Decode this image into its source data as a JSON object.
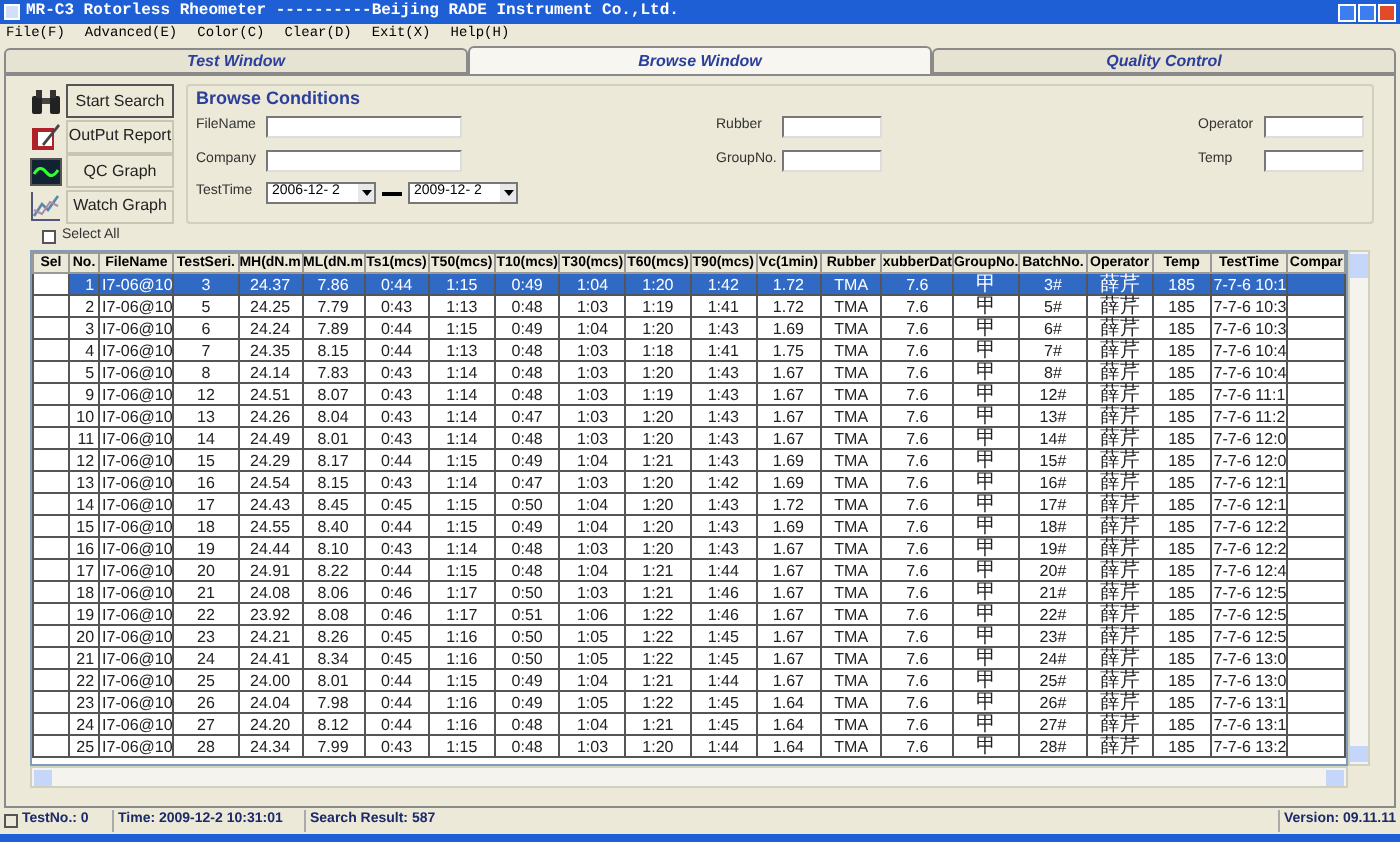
{
  "window": {
    "title": "MR-C3 Rotorless Rheometer ----------Beijing RADE Instrument Co.,Ltd."
  },
  "menu": [
    {
      "label": "File(F)"
    },
    {
      "label": "Advanced(E)"
    },
    {
      "label": "Color(C)"
    },
    {
      "label": "Clear(D)"
    },
    {
      "label": "Exit(X)"
    },
    {
      "label": "Help(H)"
    }
  ],
  "tabs": [
    {
      "label": "Test Window",
      "selected": false
    },
    {
      "label": "Browse Window",
      "selected": true
    },
    {
      "label": "Quality Control",
      "selected": false
    }
  ],
  "actions": [
    {
      "label": "Start Search"
    },
    {
      "label": "OutPut Report"
    },
    {
      "label": "QC Graph"
    },
    {
      "label": "Watch Graph"
    }
  ],
  "browse": {
    "title": "Browse Conditions",
    "fields": [
      {
        "label": "FileName"
      },
      {
        "label": "Rubber"
      },
      {
        "label": "Operator"
      },
      {
        "label": "Company"
      },
      {
        "label": "GroupNo."
      },
      {
        "label": "Temp"
      }
    ],
    "test_time": {
      "label": "TestTime",
      "from": "2006-12- 2",
      "to": "2009-12- 2"
    }
  },
  "select_all": {
    "label": "Select All",
    "checked": false
  },
  "table": {
    "columns": [
      "Sel",
      "No.",
      "FileName",
      "TestSeri.",
      "MH(dN.m",
      "ML(dN.m",
      "Ts1(mcs)",
      "T50(mcs)",
      "T10(mcs)",
      "T30(mcs)",
      "T60(mcs)",
      "T90(mcs)",
      "Vc(1min)",
      "Rubber",
      "xubberDat",
      "GroupNo.",
      "BatchNo.",
      "Operator",
      "Temp",
      "TestTime",
      "Compar"
    ],
    "rows": [
      {
        "selected": true,
        "cells": [
          "",
          "1",
          "I7-06@10",
          "3",
          "24.37",
          "7.86",
          "0:44",
          "1:15",
          "0:49",
          "1:04",
          "1:20",
          "1:42",
          "1.72",
          "TMA",
          "7.6",
          "甲",
          "3#",
          "薛芹",
          "185",
          "7-7-6 10:1"
        ]
      },
      {
        "selected": false,
        "cells": [
          "",
          "2",
          "I7-06@10",
          "5",
          "24.25",
          "7.79",
          "0:43",
          "1:13",
          "0:48",
          "1:03",
          "1:19",
          "1:41",
          "1.72",
          "TMA",
          "7.6",
          "甲",
          "5#",
          "薛芹",
          "185",
          "7-7-6 10:3"
        ]
      },
      {
        "selected": false,
        "cells": [
          "",
          "3",
          "I7-06@10",
          "6",
          "24.24",
          "7.89",
          "0:44",
          "1:15",
          "0:49",
          "1:04",
          "1:20",
          "1:43",
          "1.69",
          "TMA",
          "7.6",
          "甲",
          "6#",
          "薛芹",
          "185",
          "7-7-6 10:3"
        ]
      },
      {
        "selected": false,
        "cells": [
          "",
          "4",
          "I7-06@10",
          "7",
          "24.35",
          "8.15",
          "0:44",
          "1:13",
          "0:48",
          "1:03",
          "1:18",
          "1:41",
          "1.75",
          "TMA",
          "7.6",
          "甲",
          "7#",
          "薛芹",
          "185",
          "7-7-6 10:4"
        ]
      },
      {
        "selected": false,
        "cells": [
          "",
          "5",
          "I7-06@10",
          "8",
          "24.14",
          "7.83",
          "0:43",
          "1:14",
          "0:48",
          "1:03",
          "1:20",
          "1:43",
          "1.67",
          "TMA",
          "7.6",
          "甲",
          "8#",
          "薛芹",
          "185",
          "7-7-6 10:4"
        ]
      },
      {
        "selected": false,
        "cells": [
          "",
          "9",
          "I7-06@10",
          "12",
          "24.51",
          "8.07",
          "0:43",
          "1:14",
          "0:48",
          "1:03",
          "1:19",
          "1:43",
          "1.67",
          "TMA",
          "7.6",
          "甲",
          "12#",
          "薛芹",
          "185",
          "7-7-6 11:1"
        ]
      },
      {
        "selected": false,
        "cells": [
          "",
          "10",
          "I7-06@10",
          "13",
          "24.26",
          "8.04",
          "0:43",
          "1:14",
          "0:47",
          "1:03",
          "1:20",
          "1:43",
          "1.67",
          "TMA",
          "7.6",
          "甲",
          "13#",
          "薛芹",
          "185",
          "7-7-6 11:2"
        ]
      },
      {
        "selected": false,
        "cells": [
          "",
          "11",
          "I7-06@10",
          "14",
          "24.49",
          "8.01",
          "0:43",
          "1:14",
          "0:48",
          "1:03",
          "1:20",
          "1:43",
          "1.67",
          "TMA",
          "7.6",
          "甲",
          "14#",
          "薛芹",
          "185",
          "7-7-6 12:0"
        ]
      },
      {
        "selected": false,
        "cells": [
          "",
          "12",
          "I7-06@10",
          "15",
          "24.29",
          "8.17",
          "0:44",
          "1:15",
          "0:49",
          "1:04",
          "1:21",
          "1:43",
          "1.69",
          "TMA",
          "7.6",
          "甲",
          "15#",
          "薛芹",
          "185",
          "7-7-6 12:0"
        ]
      },
      {
        "selected": false,
        "cells": [
          "",
          "13",
          "I7-06@10",
          "16",
          "24.54",
          "8.15",
          "0:43",
          "1:14",
          "0:47",
          "1:03",
          "1:20",
          "1:42",
          "1.69",
          "TMA",
          "7.6",
          "甲",
          "16#",
          "薛芹",
          "185",
          "7-7-6 12:1"
        ]
      },
      {
        "selected": false,
        "cells": [
          "",
          "14",
          "I7-06@10",
          "17",
          "24.43",
          "8.45",
          "0:45",
          "1:15",
          "0:50",
          "1:04",
          "1:20",
          "1:43",
          "1.72",
          "TMA",
          "7.6",
          "甲",
          "17#",
          "薛芹",
          "185",
          "7-7-6 12:1"
        ]
      },
      {
        "selected": false,
        "cells": [
          "",
          "15",
          "I7-06@10",
          "18",
          "24.55",
          "8.40",
          "0:44",
          "1:15",
          "0:49",
          "1:04",
          "1:20",
          "1:43",
          "1.69",
          "TMA",
          "7.6",
          "甲",
          "18#",
          "薛芹",
          "185",
          "7-7-6 12:2"
        ]
      },
      {
        "selected": false,
        "cells": [
          "",
          "16",
          "I7-06@10",
          "19",
          "24.44",
          "8.10",
          "0:43",
          "1:14",
          "0:48",
          "1:03",
          "1:20",
          "1:43",
          "1.67",
          "TMA",
          "7.6",
          "甲",
          "19#",
          "薛芹",
          "185",
          "7-7-6 12:2"
        ]
      },
      {
        "selected": false,
        "cells": [
          "",
          "17",
          "I7-06@10",
          "20",
          "24.91",
          "8.22",
          "0:44",
          "1:15",
          "0:48",
          "1:04",
          "1:21",
          "1:44",
          "1.67",
          "TMA",
          "7.6",
          "甲",
          "20#",
          "薛芹",
          "185",
          "7-7-6 12:4"
        ]
      },
      {
        "selected": false,
        "cells": [
          "",
          "18",
          "I7-06@10",
          "21",
          "24.08",
          "8.06",
          "0:46",
          "1:17",
          "0:50",
          "1:03",
          "1:21",
          "1:46",
          "1.67",
          "TMA",
          "7.6",
          "甲",
          "21#",
          "薛芹",
          "185",
          "7-7-6 12:5"
        ]
      },
      {
        "selected": false,
        "cells": [
          "",
          "19",
          "I7-06@10",
          "22",
          "23.92",
          "8.08",
          "0:46",
          "1:17",
          "0:51",
          "1:06",
          "1:22",
          "1:46",
          "1.67",
          "TMA",
          "7.6",
          "甲",
          "22#",
          "薛芹",
          "185",
          "7-7-6 12:5"
        ]
      },
      {
        "selected": false,
        "cells": [
          "",
          "20",
          "I7-06@10",
          "23",
          "24.21",
          "8.26",
          "0:45",
          "1:16",
          "0:50",
          "1:05",
          "1:22",
          "1:45",
          "1.67",
          "TMA",
          "7.6",
          "甲",
          "23#",
          "薛芹",
          "185",
          "7-7-6 12:5"
        ]
      },
      {
        "selected": false,
        "cells": [
          "",
          "21",
          "I7-06@10",
          "24",
          "24.41",
          "8.34",
          "0:45",
          "1:16",
          "0:50",
          "1:05",
          "1:22",
          "1:45",
          "1.67",
          "TMA",
          "7.6",
          "甲",
          "24#",
          "薛芹",
          "185",
          "7-7-6 13:0"
        ]
      },
      {
        "selected": false,
        "cells": [
          "",
          "22",
          "I7-06@10",
          "25",
          "24.00",
          "8.01",
          "0:44",
          "1:15",
          "0:49",
          "1:04",
          "1:21",
          "1:44",
          "1.67",
          "TMA",
          "7.6",
          "甲",
          "25#",
          "薛芹",
          "185",
          "7-7-6 13:0"
        ]
      },
      {
        "selected": false,
        "cells": [
          "",
          "23",
          "I7-06@10",
          "26",
          "24.04",
          "7.98",
          "0:44",
          "1:16",
          "0:49",
          "1:05",
          "1:22",
          "1:45",
          "1.64",
          "TMA",
          "7.6",
          "甲",
          "26#",
          "薛芹",
          "185",
          "7-7-6 13:1"
        ]
      },
      {
        "selected": false,
        "cells": [
          "",
          "24",
          "I7-06@10",
          "27",
          "24.20",
          "8.12",
          "0:44",
          "1:16",
          "0:48",
          "1:04",
          "1:21",
          "1:45",
          "1.64",
          "TMA",
          "7.6",
          "甲",
          "27#",
          "薛芹",
          "185",
          "7-7-6 13:1"
        ]
      },
      {
        "selected": false,
        "cells": [
          "",
          "25",
          "I7-06@10",
          "28",
          "24.34",
          "7.99",
          "0:43",
          "1:15",
          "0:48",
          "1:03",
          "1:20",
          "1:44",
          "1.64",
          "TMA",
          "7.6",
          "甲",
          "28#",
          "薛芹",
          "185",
          "7-7-6 13:2"
        ]
      }
    ]
  },
  "status_bar": {
    "test_no": "TestNo.: 0",
    "time": "Time: 2009-12-2 10:31:01",
    "search_result": "Search Result: 587",
    "version": "Version: 09.11.11"
  }
}
